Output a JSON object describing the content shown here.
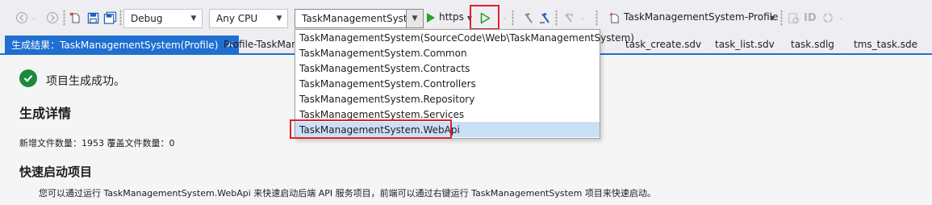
{
  "toolbar": {
    "configuration": "Debug",
    "platform": "Any CPU",
    "startup_project": "TaskManagementSyste",
    "launch_profile": "https",
    "run_profile": "TaskManagementSystem-Profile"
  },
  "tabs": [
    {
      "label": "生成结果：TaskManagementSystem(Profile)",
      "active": true
    },
    {
      "label": "Profile-TaskMana"
    },
    {
      "label": "task_create.sdv"
    },
    {
      "label": "task_list.sdv"
    },
    {
      "label": "task.sdlg"
    },
    {
      "label": "tms_task.sde"
    }
  ],
  "dropdown": {
    "options": [
      "TaskManagementSystem(SourceCode\\Web\\TaskManagementSystem)",
      "TaskManagementSystem.Common",
      "TaskManagementSystem.Contracts",
      "TaskManagementSystem.Controllers",
      "TaskManagementSystem.Repository",
      "TaskManagementSystem.Services",
      "TaskManagementSystem.WebApi"
    ],
    "selected": "TaskManagementSystem.WebApi"
  },
  "content": {
    "status": "项目生成成功。",
    "details_heading": "生成详情",
    "file_counts": "新增文件数量：1953   覆盖文件数量：0",
    "quick_heading": "快速启动项目",
    "quick_hint": "您可以通过运行 TaskManagementSystem.WebApi 来快速启动后端 API 服务项目，前端可以通过右键运行 TaskManagementSystem 项目来快速启动。"
  },
  "colors": {
    "accent": "#1f6fd0",
    "run_green": "#2e9e2e",
    "success": "#1b8a3d",
    "highlight_red": "#e0202a",
    "selected_row": "#c9e0f7"
  },
  "icons": [
    "back-icon",
    "forward-icon",
    "new-item-icon",
    "save-icon",
    "save-all-icon",
    "run-icon",
    "start-without-debugging-icon",
    "build-icon",
    "rebuild-icon",
    "clean-icon",
    "profile-icon",
    "settings-icon",
    "id-icon",
    "refresh-icon"
  ]
}
